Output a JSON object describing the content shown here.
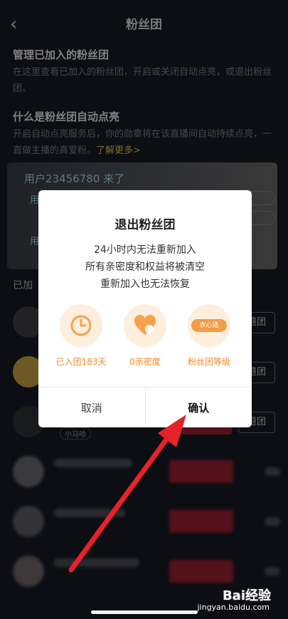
{
  "header": {
    "back_icon": "chevron-left-icon",
    "title": "粉丝团"
  },
  "manage": {
    "heading": "管理已加入的粉丝团",
    "desc": "在这里查看已加入的粉丝团，开启或关闭自动点亮，或退出粉丝团。"
  },
  "autolight": {
    "heading": "什么是粉丝团自动点亮",
    "desc": "开启自动点亮服务后，你的勋章将在该直播间自动持续点亮，一直做主播的真爱粉。",
    "link": "了解更多>"
  },
  "banner": {
    "user_text": "用户23456780 来了",
    "line_prefix": "用"
  },
  "joined": {
    "label": "已加",
    "rows": [
      {
        "btn": "退团"
      },
      {
        "btn": "退团"
      },
      {
        "btn": "退团",
        "tag": "小马哈"
      }
    ]
  },
  "dialog": {
    "title": "退出粉丝团",
    "lines": [
      "24小时内无法重新加入",
      "所有亲密度和权益将被清空",
      "重新加入也无法恢复"
    ],
    "icons": [
      {
        "icon": "clock-icon",
        "label": "已入团183天"
      },
      {
        "icon": "heart-icon",
        "label": "0亲密度"
      },
      {
        "icon": "fan-badge-icon",
        "label": "粉丝团等级",
        "badge_text": "衣心选"
      }
    ],
    "cancel": "取消",
    "confirm": "确认"
  },
  "watermark": {
    "brand": "Bai经验",
    "url": "jingyan.baidu.com"
  },
  "colors": {
    "accent": "#f28a2a",
    "link": "#e7c24c",
    "danger": "#9a1f31",
    "arrow": "#e8212a"
  }
}
